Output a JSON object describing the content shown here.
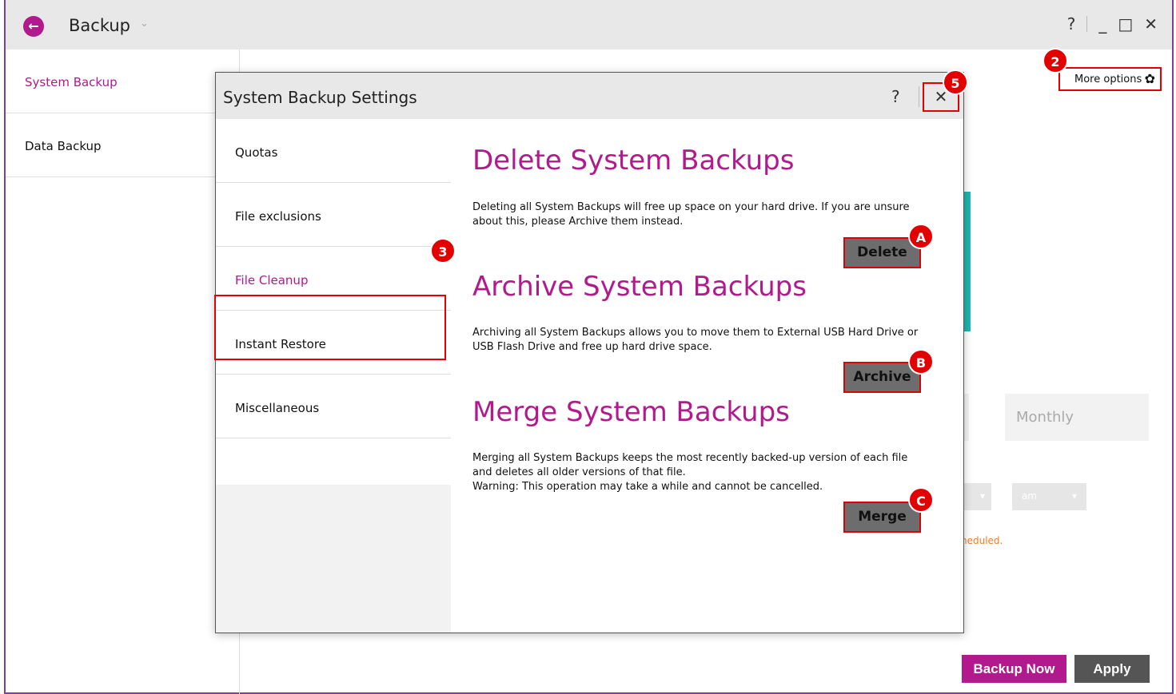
{
  "app": {
    "title": "Backup",
    "title_caret": "⌄",
    "back_icon": "←",
    "help": "?",
    "minimize": "_",
    "maximize": "□",
    "close": "✕"
  },
  "sidebar": {
    "items": [
      {
        "label": "System Backup",
        "active": true
      },
      {
        "label": "Data Backup",
        "active": false
      }
    ]
  },
  "main": {
    "more_options": "More options",
    "gear_icon": "✿",
    "monthly": "Monthly",
    "dropdown_am": "am",
    "dropdown_caret": "▾",
    "schedule_note": "heduled.",
    "backup_now": "Backup Now",
    "apply": "Apply"
  },
  "dialog": {
    "title": "System Backup Settings",
    "help": "?",
    "close": "✕",
    "nav": [
      {
        "label": "Quotas"
      },
      {
        "label": "File exclusions"
      },
      {
        "label": "File Cleanup"
      },
      {
        "label": "Instant Restore"
      },
      {
        "label": "Miscellaneous"
      }
    ],
    "sections": [
      {
        "title": "Delete System Backups",
        "desc": "Deleting all System Backups will free up space on your hard drive. If you are unsure about this, please Archive them instead.",
        "button": "Delete"
      },
      {
        "title": "Archive System Backups",
        "desc": "Archiving all System Backups allows you to move them to External USB Hard Drive or USB Flash Drive and free up hard drive space.",
        "button": "Archive"
      },
      {
        "title": "Merge System Backups",
        "desc": "Merging all System Backups keeps the most recently backed-up version of each file and deletes all older versions of that file.",
        "desc2": "Warning: This operation may take a while and cannot be cancelled.",
        "button": "Merge"
      }
    ]
  },
  "markers": {
    "more_options": "2",
    "file_cleanup": "3",
    "close": "5",
    "delete": "A",
    "archive": "B",
    "merge": "C"
  },
  "colors": {
    "accent": "#b1198c",
    "annotation": "#e30000",
    "teal": "#1fb5b0",
    "warning": "#f47b20"
  }
}
